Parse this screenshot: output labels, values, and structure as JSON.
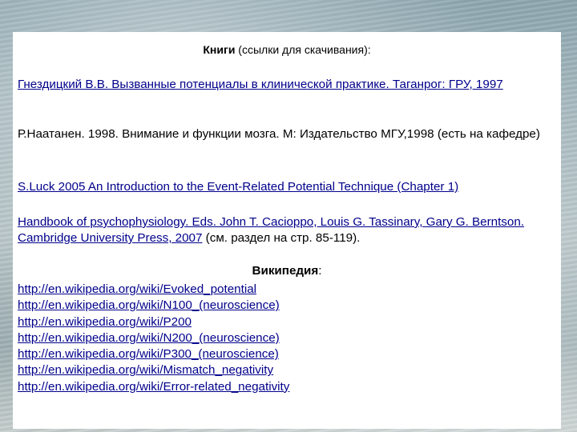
{
  "heading": {
    "bold": "Книги",
    "rest": " (ссылки для скачивания):"
  },
  "entries": [
    {
      "text": "Гнездицкий В.В. Вызванные потенциалы в клинической практике. Таганрог: ГРУ, 1997",
      "is_link": true
    },
    {
      "text": "Р.Наатанен. 1998. Внимание и функции мозга. М: Издательство МГУ,1998 (есть на кафедре)",
      "is_link": false
    },
    {
      "text": "S.Luck 2005 An Introduction to the Event-Related Potential Technique (Chapter 1)",
      "is_link": true
    },
    {
      "link_text": "Handbook of psychophysiology. Eds. John T. Cacioppo, Louis G. Tassinary, Gary G. Berntson. Cambridge University Press, 2007",
      "suffix": " (см.  раздел на стр. 85-119)."
    }
  ],
  "wiki": {
    "title_bold": "Википедия",
    "title_rest": ":",
    "links": [
      "http://en.wikipedia.org/wiki/Evoked_potential",
      "http://en.wikipedia.org/wiki/N100_(neuroscience)",
      "http://en.wikipedia.org/wiki/P200",
      "http://en.wikipedia.org/wiki/N200_(neuroscience)",
      "http://en.wikipedia.org/wiki/P300_(neuroscience)",
      "http://en.wikipedia.org/wiki/Mismatch_negativity",
      "http://en.wikipedia.org/wiki/Error-related_negativity"
    ]
  },
  "colors": {
    "link": "#00008b",
    "panel": "#ffffff"
  }
}
